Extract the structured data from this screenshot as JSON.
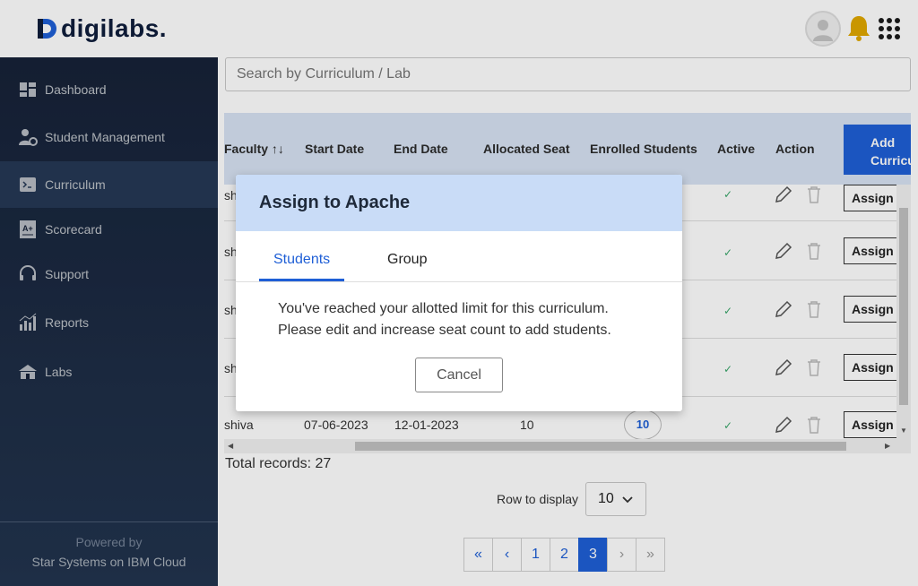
{
  "header": {
    "brand": "digilabs."
  },
  "sidebar": {
    "items": [
      {
        "label": "Dashboard",
        "icon": "dashboard-icon"
      },
      {
        "label": "Student Management",
        "icon": "user-gear-icon"
      },
      {
        "label": "Curriculum",
        "icon": "terminal-icon"
      },
      {
        "label": "Scorecard",
        "icon": "scorecard-icon"
      },
      {
        "label": "Support",
        "icon": "headset-icon"
      },
      {
        "label": "Reports",
        "icon": "bar-chart-icon"
      },
      {
        "label": "Labs",
        "icon": "labs-icon"
      }
    ],
    "footer_line1": "Powered by",
    "footer_line2": "Star Systems on IBM Cloud"
  },
  "search": {
    "placeholder": "Search by Curriculum / Lab"
  },
  "table": {
    "columns": [
      "Faculty ↑↓",
      "Start Date",
      "End Date",
      "Allocated Seat",
      "Enrolled Students",
      "Active",
      "Action"
    ],
    "add_button": "Add Curriculum",
    "rows": [
      {
        "faculty": "sh",
        "start": "",
        "end": "",
        "seat": "",
        "active": "✓",
        "assign": "Assign"
      },
      {
        "faculty": "sh",
        "start": "",
        "end": "",
        "seat": "",
        "active": "✓",
        "assign": "Assign"
      },
      {
        "faculty": "sh",
        "start": "",
        "end": "",
        "seat": "",
        "active": "✓",
        "assign": "Assign"
      },
      {
        "faculty": "sh",
        "start": "",
        "end": "",
        "seat": "",
        "active": "✓",
        "assign": "Assign"
      },
      {
        "faculty": "shiva",
        "start": "07-06-2023",
        "end": "12-01-2023",
        "seat": "10",
        "enrolled": "10",
        "active": "✓",
        "assign": "Assign"
      }
    ]
  },
  "footer": {
    "total": "Total records: 27",
    "rows_label": "Row to display",
    "rows_value": "10",
    "pages": [
      "«",
      "‹",
      "1",
      "2",
      "3",
      "›",
      "»"
    ],
    "current_page": "3"
  },
  "modal": {
    "title": "Assign to Apache",
    "tabs": [
      "Students",
      "Group"
    ],
    "message_line1": "You've reached your allotted limit for this curriculum.",
    "message_line2": "Please edit and increase seat count to add students.",
    "cancel": "Cancel"
  },
  "colors": {
    "primary": "#1f5fd6",
    "sidebar": "#1c2a45",
    "modal_head": "#c9dcf7",
    "bell": "#e0a800"
  }
}
